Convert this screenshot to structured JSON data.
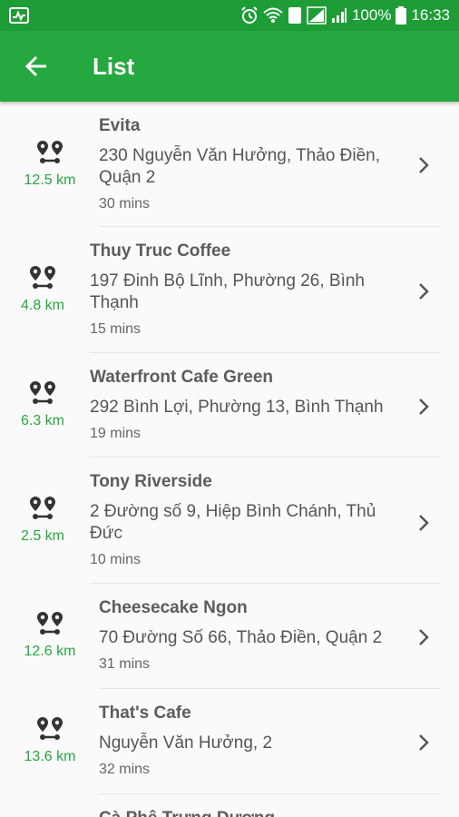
{
  "status": {
    "battery": "100%",
    "time": "16:33",
    "sim": "1"
  },
  "header": {
    "title": "List"
  },
  "accent": "#25a83f",
  "items": [
    {
      "name": "Evita",
      "address": "230 Nguyễn Văn Hưởng, Thảo Điền, Quận 2",
      "time": "30 mins",
      "distance": "12.5 km"
    },
    {
      "name": "Thuy Truc Coffee",
      "address": "197 Đinh Bộ Lĩnh, Phường 26, Bình Thạnh",
      "time": "15 mins",
      "distance": "4.8 km"
    },
    {
      "name": "Waterfront Cafe Green",
      "address": "292 Bình Lợi, Phường 13, Bình Thạnh",
      "time": "19 mins",
      "distance": "6.3 km"
    },
    {
      "name": "Tony Riverside",
      "address": "2 Đường số 9, Hiệp Bình Chánh, Thủ Đức",
      "time": "10 mins",
      "distance": "2.5 km"
    },
    {
      "name": "Cheesecake Ngon",
      "address": "70 Đường Số 66, Thảo Điền, Quận 2",
      "time": "31 mins",
      "distance": "12.6 km"
    },
    {
      "name": "That's Cafe",
      "address": "Nguyễn Văn Hưởng, 2",
      "time": "32 mins",
      "distance": "13.6 km"
    },
    {
      "name": "Cà Phê Trưng Dương",
      "address": "",
      "time": "",
      "distance": ""
    }
  ]
}
